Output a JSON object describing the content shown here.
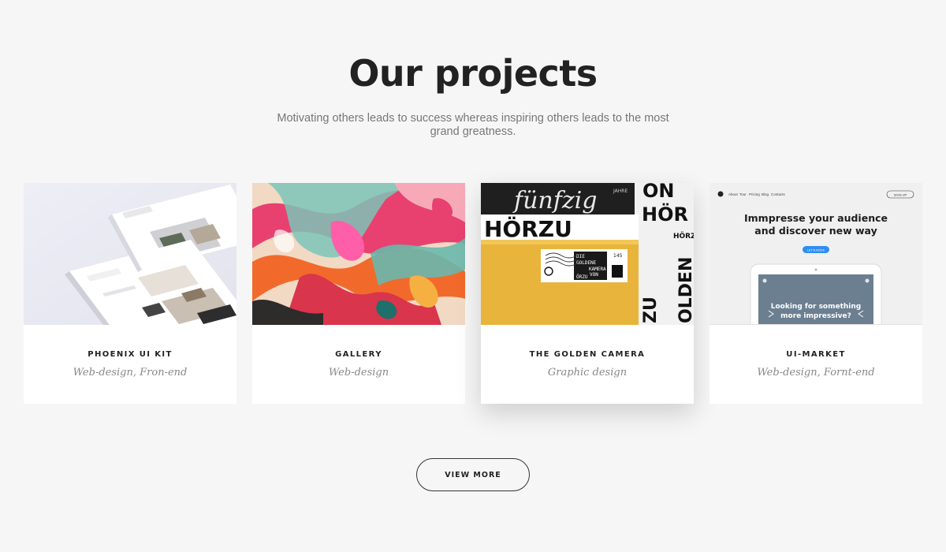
{
  "section": {
    "title": "Our projects",
    "subtitle": "Motivating others leads to success whereas inspiring others leads to the most grand greatness."
  },
  "projects": [
    {
      "title": "PHOENIX UI KIT",
      "category": "Web-design, Fron-end",
      "image": "ui-kit-mockup"
    },
    {
      "title": "GALLERY",
      "category": "Web-design",
      "image": "abstract-paint"
    },
    {
      "title": "THE GOLDEN CAMERA",
      "category": "Graphic design",
      "image": "golden-envelope"
    },
    {
      "title": "UI-MARKET",
      "category": "Web-design, Fornt-end",
      "image": "landing-page"
    }
  ],
  "posters": {
    "script_word": "fünfzig",
    "script_small": "JAHRE",
    "brand": "HÖRZU",
    "big_letters_1": "ON",
    "big_letters_2": "HÖR",
    "vertical_1": "ZU",
    "vertical_2": "OLDEN",
    "stamp_text_1": "DIE",
    "stamp_text_2": "GOLDENE",
    "stamp_text_3": "KAMERA",
    "stamp_text_4": "VON",
    "stamp_text_5": "ÖRZU",
    "stamp_value": "145"
  },
  "ui_market_mock": {
    "nav": [
      "About",
      "Tour",
      "Pricing",
      "Blog",
      "Contacts"
    ],
    "signup": "SIGN UP",
    "headline_1": "Immpresse your audience",
    "headline_2": "and discover new way",
    "cta": "LET'S ROCK",
    "tablet_text_1": "Looking for something",
    "tablet_text_2": "more impressive?"
  },
  "actions": {
    "view_more": "VIEW MORE"
  },
  "colors": {
    "background": "#f6f6f6",
    "card": "#ffffff",
    "accent_blue": "#2f8ef4",
    "envelope_gold": "#e9b43c"
  }
}
